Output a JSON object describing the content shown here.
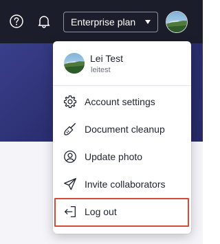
{
  "topbar": {
    "help_icon": "help-circle-icon",
    "bell_icon": "bell-icon",
    "plan_label": "Enterprise plan",
    "plan_caret_icon": "caret-down-icon",
    "avatar_icon": "user-avatar"
  },
  "menu": {
    "profile": {
      "name": "Lei Test",
      "username": "leitest"
    },
    "items": [
      {
        "label": "Account settings",
        "icon": "gear-icon"
      },
      {
        "label": "Document cleanup",
        "icon": "broom-icon"
      },
      {
        "label": "Update photo",
        "icon": "user-circle-icon"
      },
      {
        "label": "Invite collaborators",
        "icon": "paper-plane-icon"
      },
      {
        "label": "Log out",
        "icon": "logout-icon"
      }
    ],
    "highlight_color": "#d44a32"
  },
  "colors": {
    "topbar": "#1b1e2a",
    "banner": "#2b2f70",
    "text": "#1f2230"
  }
}
